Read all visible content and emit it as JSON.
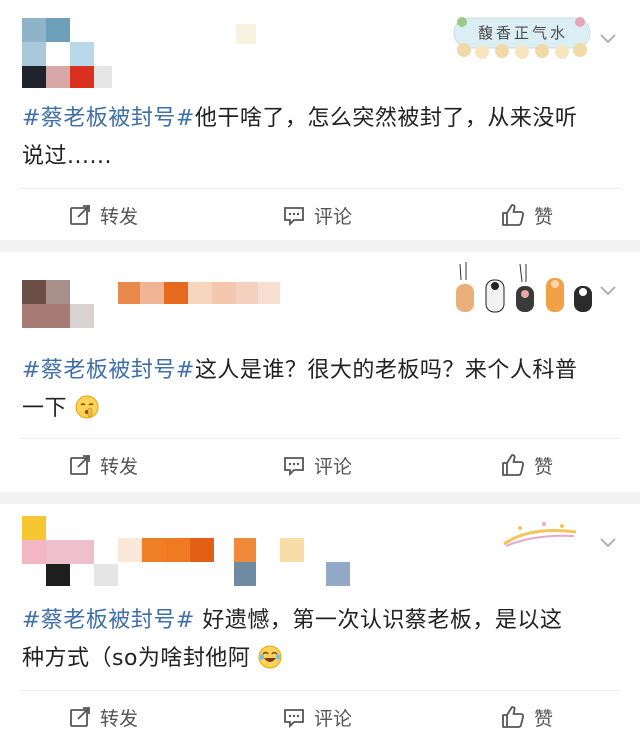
{
  "posts": [
    {
      "hashtag": "#蔡老板被封号#",
      "text_line1": "他干啥了，怎么突然被封了，从来没听",
      "text_line2": "说过......",
      "sticker_text": "馥香正气水",
      "actions": {
        "repost": "转发",
        "comment": "评论",
        "like": "赞"
      }
    },
    {
      "hashtag": "#蔡老板被封号#",
      "text_line1": "这人是谁？很大的老板吗？来个人科普",
      "text_line2": "一下",
      "emoji": "shushing-face",
      "actions": {
        "repost": "转发",
        "comment": "评论",
        "like": "赞"
      }
    },
    {
      "hashtag": "#蔡老板被封号#",
      "text_line1": " 好遗憾，第一次认识蔡老板，是以这",
      "text_line2": "种方式（so为啥封他阿",
      "emoji": "crying-laughing-face",
      "actions": {
        "repost": "转发",
        "comment": "评论",
        "like": "赞"
      }
    }
  ],
  "colors": {
    "hashtag": "#3f6ea8",
    "text": "#222222",
    "action_text": "#555555",
    "background": "#f2f2f2"
  },
  "icons": [
    "repost-icon",
    "comment-icon",
    "like-icon",
    "chevron-down-icon"
  ]
}
